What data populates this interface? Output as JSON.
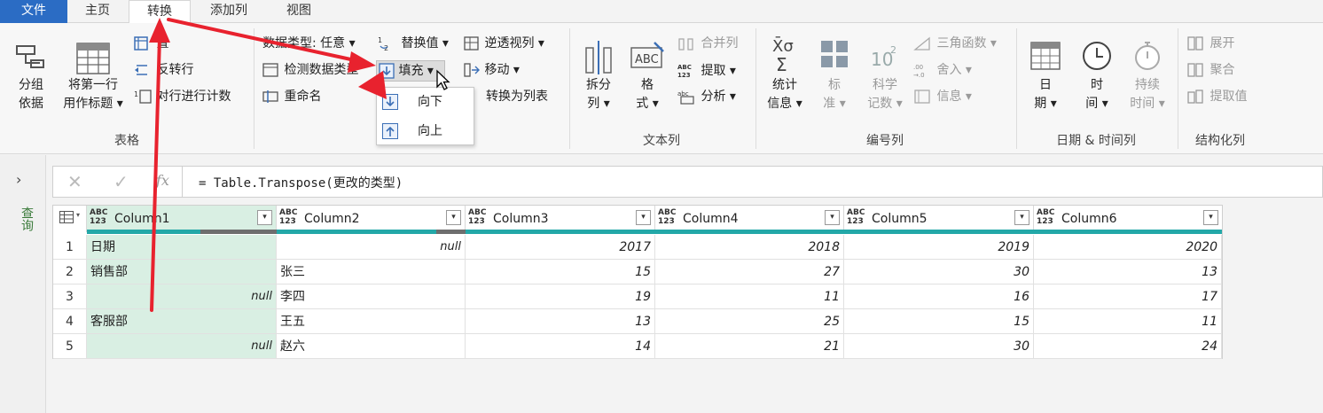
{
  "tabs": {
    "file": "文件",
    "home": "主页",
    "transform": "转换",
    "add_column": "添加列",
    "view": "视图"
  },
  "ribbon": {
    "table_group": {
      "group_by": [
        "分组",
        "依据"
      ],
      "use_first_row": [
        "将第一行",
        "用作标题"
      ],
      "transpose_partial": "置",
      "reverse_rows_partial": "反转行",
      "count_rows_partial": "对行进行计数",
      "label": "表格"
    },
    "any_column_group": {
      "data_type_partial": "数据类型: 任意",
      "detect_type_partial": "检测数据类型",
      "rename": "重命名",
      "replace_values": "替换值",
      "fill": "填充",
      "unpivot": "逆透视列",
      "move": "移动",
      "convert_to_list": "转换为列表"
    },
    "fill_dropdown": {
      "down": "向下",
      "up": "向上"
    },
    "text_column_group": {
      "split_column": [
        "拆分",
        "列"
      ],
      "format": [
        "格",
        "式"
      ],
      "merge_columns": "合并列",
      "extract": "提取",
      "parse": "分析",
      "label": "文本列"
    },
    "number_column_group": {
      "statistics": [
        "统计",
        "信息"
      ],
      "standard": [
        "标",
        "准"
      ],
      "scientific": [
        "科学",
        "记数"
      ],
      "trigonometry": "三角函数",
      "rounding": "舍入",
      "information": "信息",
      "label": "编号列"
    },
    "datetime_group": {
      "date": [
        "日",
        "期"
      ],
      "time": [
        "时",
        "间"
      ],
      "duration": [
        "持续",
        "时间"
      ],
      "label": "日期 & 时间列"
    },
    "structured_group": {
      "expand": "展开",
      "aggregate": "聚合",
      "extract_values": "提取值",
      "label": "结构化列"
    }
  },
  "left_panel": {
    "queries_label": "查询"
  },
  "formula_bar": {
    "fx": "fx",
    "formula": "= Table.Transpose(更改的类型)"
  },
  "table": {
    "type_label_top": "ABC",
    "type_label_bottom": "123",
    "columns": [
      "Column1",
      "Column2",
      "Column3",
      "Column4",
      "Column5",
      "Column6"
    ],
    "rows": [
      {
        "n": "1",
        "c": [
          "日期",
          "null",
          "2017",
          "2018",
          "2019",
          "2020"
        ]
      },
      {
        "n": "2",
        "c": [
          "销售部",
          "张三",
          "15",
          "27",
          "30",
          "13"
        ]
      },
      {
        "n": "3",
        "c": [
          "null",
          "李四",
          "19",
          "11",
          "16",
          "17"
        ]
      },
      {
        "n": "4",
        "c": [
          "客服部",
          "王五",
          "13",
          "25",
          "15",
          "11"
        ]
      },
      {
        "n": "5",
        "c": [
          "null",
          "赵六",
          "14",
          "21",
          "30",
          "24"
        ]
      }
    ]
  },
  "colors": {
    "file_tab": "#2b6cc4",
    "quality_bar": "#23a8a8",
    "selected_column": "#d9efe3",
    "arrow": "#e8222e"
  }
}
